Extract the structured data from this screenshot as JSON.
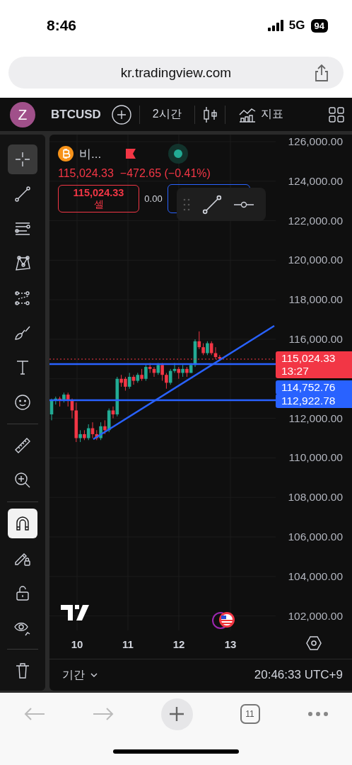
{
  "status_bar": {
    "time": "8:46",
    "network": "5G",
    "battery": "94"
  },
  "browser": {
    "url": "kr.tradingview.com",
    "tab_count": "11"
  },
  "top_bar": {
    "avatar": "Z",
    "symbol": "BTCUSD",
    "interval": "2시간",
    "indicators": "지표"
  },
  "tool_groups": [
    [
      {
        "selected": true
      },
      {
        "selected": false
      },
      {
        "selected": false
      },
      {
        "selected": false
      },
      {
        "selected": false
      },
      {
        "selected": false
      },
      {
        "selected": false
      },
      {
        "selected": false
      }
    ],
    [
      {
        "selected": false
      },
      {
        "selected": false
      }
    ],
    [
      {
        "on": true
      },
      {
        "on": false
      },
      {
        "on": false
      },
      {
        "on": false
      }
    ]
  ],
  "legend": {
    "name": "비...",
    "price": "115,024.33",
    "change": "−472.65 (−0.41%)",
    "sell_price": "115,024.33",
    "sell_label": "셀",
    "spread": "0.00"
  },
  "price_axis": [
    "126,000.00",
    "124,000.00",
    "122,000.00",
    "120,000.00",
    "118,000.00",
    "116,000.00",
    "112,000.00",
    "110,000.00",
    "108,000.00",
    "106,000.00",
    "104,000.00",
    "102,000.00"
  ],
  "price_tags": [
    {
      "kind": "last",
      "price": "115,024.33",
      "countdown": "13:27",
      "color": "#f23645"
    },
    {
      "kind": "line",
      "price": "114,752.76",
      "color": "#2962ff"
    },
    {
      "kind": "line",
      "price": "112,922.78",
      "color": "#2962ff"
    }
  ],
  "time_axis": [
    "10",
    "11",
    "12",
    "13"
  ],
  "bottom_bar": {
    "range": "기간",
    "clock": "20:46:33 UTC+9"
  }
}
